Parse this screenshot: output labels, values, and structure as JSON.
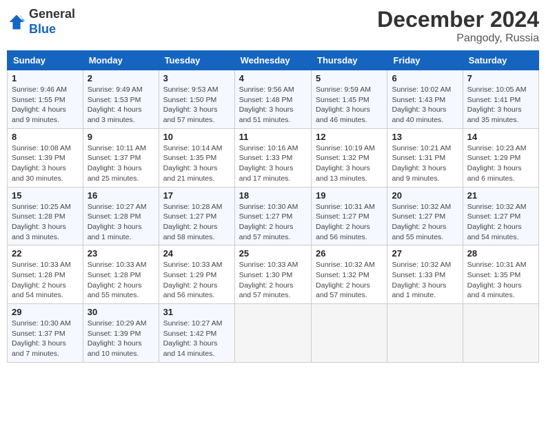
{
  "header": {
    "logo_general": "General",
    "logo_blue": "Blue",
    "month_title": "December 2024",
    "location": "Pangody, Russia"
  },
  "days_of_week": [
    "Sunday",
    "Monday",
    "Tuesday",
    "Wednesday",
    "Thursday",
    "Friday",
    "Saturday"
  ],
  "weeks": [
    [
      {
        "day": "1",
        "info": "Sunrise: 9:46 AM\nSunset: 1:55 PM\nDaylight: 4 hours\nand 9 minutes."
      },
      {
        "day": "2",
        "info": "Sunrise: 9:49 AM\nSunset: 1:53 PM\nDaylight: 4 hours\nand 3 minutes."
      },
      {
        "day": "3",
        "info": "Sunrise: 9:53 AM\nSunset: 1:50 PM\nDaylight: 3 hours\nand 57 minutes."
      },
      {
        "day": "4",
        "info": "Sunrise: 9:56 AM\nSunset: 1:48 PM\nDaylight: 3 hours\nand 51 minutes."
      },
      {
        "day": "5",
        "info": "Sunrise: 9:59 AM\nSunset: 1:45 PM\nDaylight: 3 hours\nand 46 minutes."
      },
      {
        "day": "6",
        "info": "Sunrise: 10:02 AM\nSunset: 1:43 PM\nDaylight: 3 hours\nand 40 minutes."
      },
      {
        "day": "7",
        "info": "Sunrise: 10:05 AM\nSunset: 1:41 PM\nDaylight: 3 hours\nand 35 minutes."
      }
    ],
    [
      {
        "day": "8",
        "info": "Sunrise: 10:08 AM\nSunset: 1:39 PM\nDaylight: 3 hours\nand 30 minutes."
      },
      {
        "day": "9",
        "info": "Sunrise: 10:11 AM\nSunset: 1:37 PM\nDaylight: 3 hours\nand 25 minutes."
      },
      {
        "day": "10",
        "info": "Sunrise: 10:14 AM\nSunset: 1:35 PM\nDaylight: 3 hours\nand 21 minutes."
      },
      {
        "day": "11",
        "info": "Sunrise: 10:16 AM\nSunset: 1:33 PM\nDaylight: 3 hours\nand 17 minutes."
      },
      {
        "day": "12",
        "info": "Sunrise: 10:19 AM\nSunset: 1:32 PM\nDaylight: 3 hours\nand 13 minutes."
      },
      {
        "day": "13",
        "info": "Sunrise: 10:21 AM\nSunset: 1:31 PM\nDaylight: 3 hours\nand 9 minutes."
      },
      {
        "day": "14",
        "info": "Sunrise: 10:23 AM\nSunset: 1:29 PM\nDaylight: 3 hours\nand 6 minutes."
      }
    ],
    [
      {
        "day": "15",
        "info": "Sunrise: 10:25 AM\nSunset: 1:28 PM\nDaylight: 3 hours\nand 3 minutes."
      },
      {
        "day": "16",
        "info": "Sunrise: 10:27 AM\nSunset: 1:28 PM\nDaylight: 3 hours\nand 1 minute."
      },
      {
        "day": "17",
        "info": "Sunrise: 10:28 AM\nSunset: 1:27 PM\nDaylight: 2 hours\nand 58 minutes."
      },
      {
        "day": "18",
        "info": "Sunrise: 10:30 AM\nSunset: 1:27 PM\nDaylight: 2 hours\nand 57 minutes."
      },
      {
        "day": "19",
        "info": "Sunrise: 10:31 AM\nSunset: 1:27 PM\nDaylight: 2 hours\nand 56 minutes."
      },
      {
        "day": "20",
        "info": "Sunrise: 10:32 AM\nSunset: 1:27 PM\nDaylight: 2 hours\nand 55 minutes."
      },
      {
        "day": "21",
        "info": "Sunrise: 10:32 AM\nSunset: 1:27 PM\nDaylight: 2 hours\nand 54 minutes."
      }
    ],
    [
      {
        "day": "22",
        "info": "Sunrise: 10:33 AM\nSunset: 1:28 PM\nDaylight: 2 hours\nand 54 minutes."
      },
      {
        "day": "23",
        "info": "Sunrise: 10:33 AM\nSunset: 1:28 PM\nDaylight: 2 hours\nand 55 minutes."
      },
      {
        "day": "24",
        "info": "Sunrise: 10:33 AM\nSunset: 1:29 PM\nDaylight: 2 hours\nand 56 minutes."
      },
      {
        "day": "25",
        "info": "Sunrise: 10:33 AM\nSunset: 1:30 PM\nDaylight: 2 hours\nand 57 minutes."
      },
      {
        "day": "26",
        "info": "Sunrise: 10:32 AM\nSunset: 1:32 PM\nDaylight: 2 hours\nand 57 minutes."
      },
      {
        "day": "27",
        "info": "Sunrise: 10:32 AM\nSunset: 1:33 PM\nDaylight: 3 hours\nand 1 minute."
      },
      {
        "day": "28",
        "info": "Sunrise: 10:31 AM\nSunset: 1:35 PM\nDaylight: 3 hours\nand 4 minutes."
      }
    ],
    [
      {
        "day": "29",
        "info": "Sunrise: 10:30 AM\nSunset: 1:37 PM\nDaylight: 3 hours\nand 7 minutes."
      },
      {
        "day": "30",
        "info": "Sunrise: 10:29 AM\nSunset: 1:39 PM\nDaylight: 3 hours\nand 10 minutes."
      },
      {
        "day": "31",
        "info": "Sunrise: 10:27 AM\nSunset: 1:42 PM\nDaylight: 3 hours\nand 14 minutes."
      },
      {
        "day": "",
        "info": ""
      },
      {
        "day": "",
        "info": ""
      },
      {
        "day": "",
        "info": ""
      },
      {
        "day": "",
        "info": ""
      }
    ]
  ]
}
